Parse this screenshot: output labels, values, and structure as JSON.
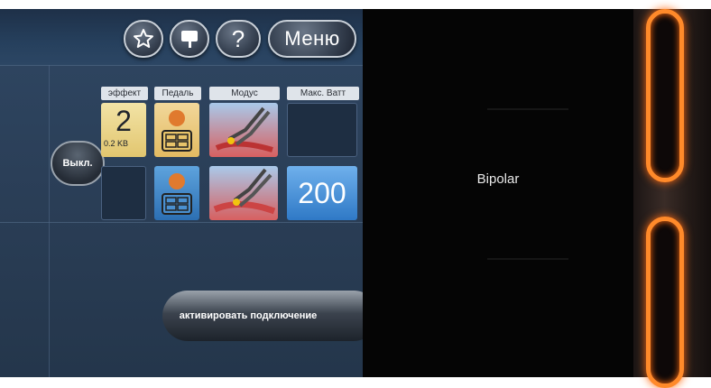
{
  "header": {
    "star_icon": "star-icon",
    "flag_icon": "flag-icon",
    "help_label": "?",
    "menu_label": "Меню"
  },
  "columns": [
    "эффект",
    "Педаль",
    "Модус",
    "Макс. Ватт"
  ],
  "rows": [
    {
      "effect_value": "2",
      "effect_sub": "0.2 KB",
      "pedal_color": "yellow",
      "mode_icon": "bipolar-forceps-icon",
      "watt_value": ""
    },
    {
      "effect_value": "",
      "effect_sub": "",
      "pedal_color": "blue",
      "mode_icon": "bipolar-forceps-icon",
      "watt_value": "200"
    }
  ],
  "off_button": "Выкл.",
  "activate_button": "активировать подключение",
  "side_display": {
    "label": "Bipolar"
  },
  "colors": {
    "accent_orange": "#ff8a2a",
    "tile_blue": "#2f79c6",
    "tile_yellow": "#e2c66f"
  }
}
